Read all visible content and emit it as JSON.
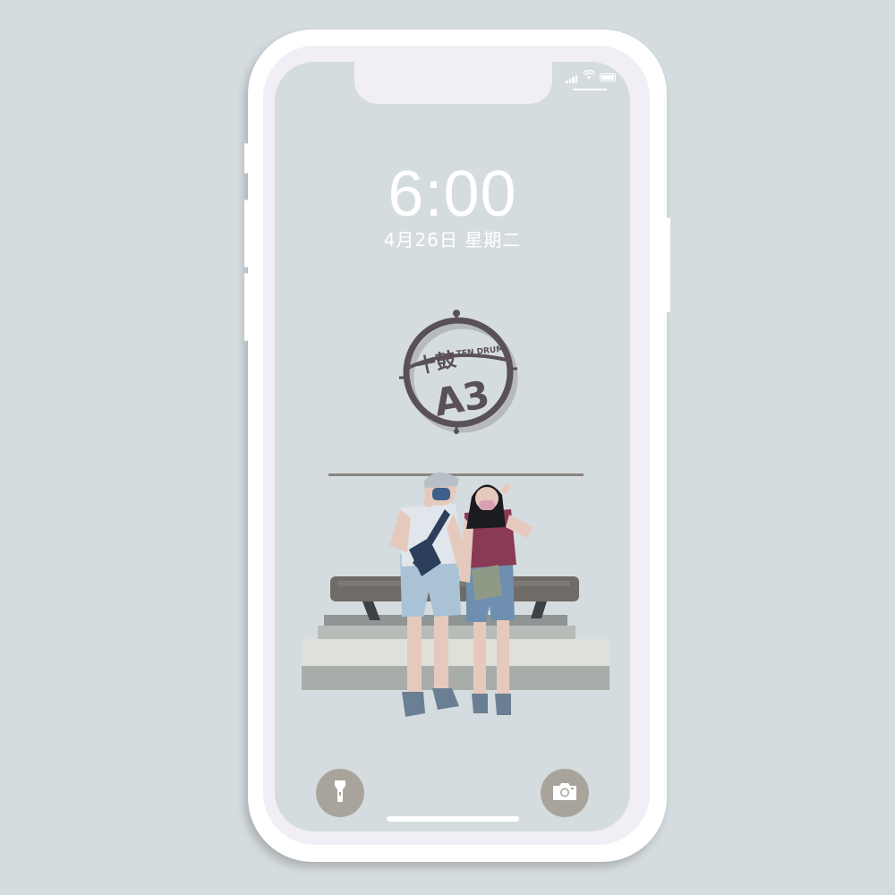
{
  "lock_screen": {
    "time": "6:00",
    "date": "4月26日 星期二"
  },
  "logo": {
    "text_primary": "A3",
    "text_secondary": "TEN DRUM",
    "text_chinese": "十鼓",
    "icon": "drum-target-logo"
  },
  "controls": {
    "left_icon": "flashlight-icon",
    "right_icon": "camera-icon"
  },
  "status_bar": {
    "icons": [
      "signal-icon",
      "wifi-icon",
      "battery-icon"
    ]
  },
  "colors": {
    "background": "#d5dcdf",
    "phone_frame": "#ffffff",
    "logo": "#5a5158",
    "control_button": "#a8a49c"
  }
}
